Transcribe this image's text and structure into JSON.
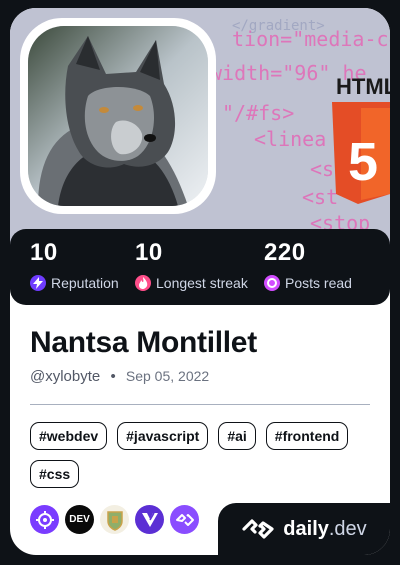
{
  "profile": {
    "name": "Nantsa Montillet",
    "handle": "@xylobyte",
    "separator": "•",
    "joined": "Sep 05, 2022"
  },
  "stats": [
    {
      "value": "10",
      "label": "Reputation",
      "icon": "lightning-icon",
      "color": "#9b5cf6"
    },
    {
      "value": "10",
      "label": "Longest streak",
      "icon": "flame-icon",
      "color": "#ff4e8a"
    },
    {
      "value": "220",
      "label": "Posts read",
      "icon": "ring-icon",
      "color": "#d24dff"
    }
  ],
  "tags": [
    "#webdev",
    "#javascript",
    "#ai",
    "#frontend",
    "#css"
  ],
  "cover": {
    "code_lines": [
      "tion=\"media-contr",
      "width=\"96\" he",
      "\"/#fs>",
      "<linea",
      "<s",
      "<st",
      "<stop"
    ],
    "html_badge": "HTML",
    "html_number": "5"
  },
  "badges": [
    "crosshair-badge-icon",
    "dev-community-icon",
    "crest-icon",
    "vue-style-icon",
    "dailydev-squad-icon"
  ],
  "badge_text": {
    "dev": "DEV"
  },
  "brand": {
    "name_main": "daily",
    "name_suffix": ".dev"
  },
  "colors": {
    "card_bg": "#ffffff",
    "dark": "#0e1217",
    "accent_purple": "#7a3cff",
    "html5_orange": "#e44d26"
  }
}
